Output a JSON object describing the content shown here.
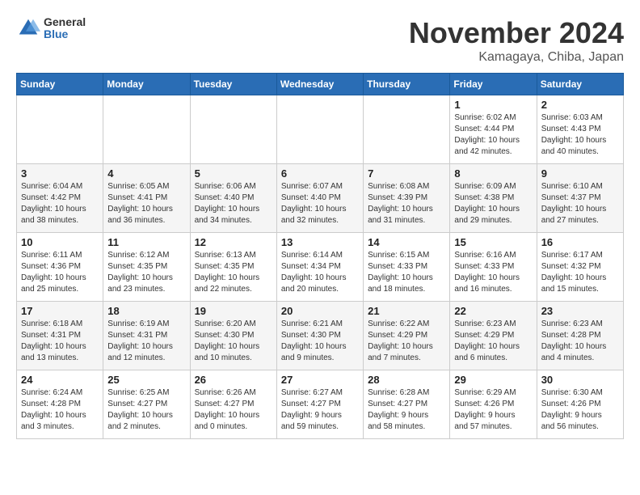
{
  "logo": {
    "general": "General",
    "blue": "Blue"
  },
  "title": "November 2024",
  "location": "Kamagaya, Chiba, Japan",
  "weekdays": [
    "Sunday",
    "Monday",
    "Tuesday",
    "Wednesday",
    "Thursday",
    "Friday",
    "Saturday"
  ],
  "weeks": [
    [
      {
        "day": "",
        "info": ""
      },
      {
        "day": "",
        "info": ""
      },
      {
        "day": "",
        "info": ""
      },
      {
        "day": "",
        "info": ""
      },
      {
        "day": "",
        "info": ""
      },
      {
        "day": "1",
        "info": "Sunrise: 6:02 AM\nSunset: 4:44 PM\nDaylight: 10 hours\nand 42 minutes."
      },
      {
        "day": "2",
        "info": "Sunrise: 6:03 AM\nSunset: 4:43 PM\nDaylight: 10 hours\nand 40 minutes."
      }
    ],
    [
      {
        "day": "3",
        "info": "Sunrise: 6:04 AM\nSunset: 4:42 PM\nDaylight: 10 hours\nand 38 minutes."
      },
      {
        "day": "4",
        "info": "Sunrise: 6:05 AM\nSunset: 4:41 PM\nDaylight: 10 hours\nand 36 minutes."
      },
      {
        "day": "5",
        "info": "Sunrise: 6:06 AM\nSunset: 4:40 PM\nDaylight: 10 hours\nand 34 minutes."
      },
      {
        "day": "6",
        "info": "Sunrise: 6:07 AM\nSunset: 4:40 PM\nDaylight: 10 hours\nand 32 minutes."
      },
      {
        "day": "7",
        "info": "Sunrise: 6:08 AM\nSunset: 4:39 PM\nDaylight: 10 hours\nand 31 minutes."
      },
      {
        "day": "8",
        "info": "Sunrise: 6:09 AM\nSunset: 4:38 PM\nDaylight: 10 hours\nand 29 minutes."
      },
      {
        "day": "9",
        "info": "Sunrise: 6:10 AM\nSunset: 4:37 PM\nDaylight: 10 hours\nand 27 minutes."
      }
    ],
    [
      {
        "day": "10",
        "info": "Sunrise: 6:11 AM\nSunset: 4:36 PM\nDaylight: 10 hours\nand 25 minutes."
      },
      {
        "day": "11",
        "info": "Sunrise: 6:12 AM\nSunset: 4:35 PM\nDaylight: 10 hours\nand 23 minutes."
      },
      {
        "day": "12",
        "info": "Sunrise: 6:13 AM\nSunset: 4:35 PM\nDaylight: 10 hours\nand 22 minutes."
      },
      {
        "day": "13",
        "info": "Sunrise: 6:14 AM\nSunset: 4:34 PM\nDaylight: 10 hours\nand 20 minutes."
      },
      {
        "day": "14",
        "info": "Sunrise: 6:15 AM\nSunset: 4:33 PM\nDaylight: 10 hours\nand 18 minutes."
      },
      {
        "day": "15",
        "info": "Sunrise: 6:16 AM\nSunset: 4:33 PM\nDaylight: 10 hours\nand 16 minutes."
      },
      {
        "day": "16",
        "info": "Sunrise: 6:17 AM\nSunset: 4:32 PM\nDaylight: 10 hours\nand 15 minutes."
      }
    ],
    [
      {
        "day": "17",
        "info": "Sunrise: 6:18 AM\nSunset: 4:31 PM\nDaylight: 10 hours\nand 13 minutes."
      },
      {
        "day": "18",
        "info": "Sunrise: 6:19 AM\nSunset: 4:31 PM\nDaylight: 10 hours\nand 12 minutes."
      },
      {
        "day": "19",
        "info": "Sunrise: 6:20 AM\nSunset: 4:30 PM\nDaylight: 10 hours\nand 10 minutes."
      },
      {
        "day": "20",
        "info": "Sunrise: 6:21 AM\nSunset: 4:30 PM\nDaylight: 10 hours\nand 9 minutes."
      },
      {
        "day": "21",
        "info": "Sunrise: 6:22 AM\nSunset: 4:29 PM\nDaylight: 10 hours\nand 7 minutes."
      },
      {
        "day": "22",
        "info": "Sunrise: 6:23 AM\nSunset: 4:29 PM\nDaylight: 10 hours\nand 6 minutes."
      },
      {
        "day": "23",
        "info": "Sunrise: 6:23 AM\nSunset: 4:28 PM\nDaylight: 10 hours\nand 4 minutes."
      }
    ],
    [
      {
        "day": "24",
        "info": "Sunrise: 6:24 AM\nSunset: 4:28 PM\nDaylight: 10 hours\nand 3 minutes."
      },
      {
        "day": "25",
        "info": "Sunrise: 6:25 AM\nSunset: 4:27 PM\nDaylight: 10 hours\nand 2 minutes."
      },
      {
        "day": "26",
        "info": "Sunrise: 6:26 AM\nSunset: 4:27 PM\nDaylight: 10 hours\nand 0 minutes."
      },
      {
        "day": "27",
        "info": "Sunrise: 6:27 AM\nSunset: 4:27 PM\nDaylight: 9 hours\nand 59 minutes."
      },
      {
        "day": "28",
        "info": "Sunrise: 6:28 AM\nSunset: 4:27 PM\nDaylight: 9 hours\nand 58 minutes."
      },
      {
        "day": "29",
        "info": "Sunrise: 6:29 AM\nSunset: 4:26 PM\nDaylight: 9 hours\nand 57 minutes."
      },
      {
        "day": "30",
        "info": "Sunrise: 6:30 AM\nSunset: 4:26 PM\nDaylight: 9 hours\nand 56 minutes."
      }
    ]
  ]
}
